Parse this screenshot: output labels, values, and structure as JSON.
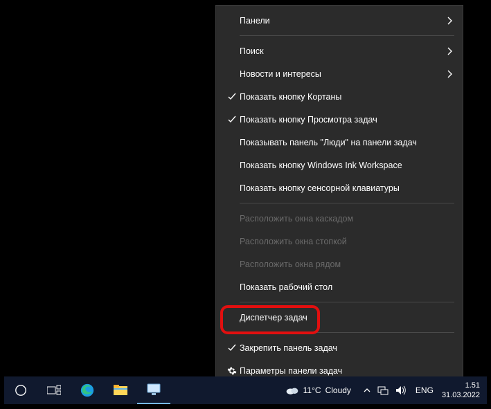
{
  "menu": {
    "items": [
      {
        "label": "Панели",
        "submenu": true
      },
      {
        "sep": true
      },
      {
        "label": "Поиск",
        "submenu": true
      },
      {
        "label": "Новости и интересы",
        "submenu": true
      },
      {
        "label": "Показать кнопку Кортаны",
        "checked": true
      },
      {
        "label": "Показать кнопку Просмотра задач",
        "checked": true
      },
      {
        "label": "Показывать панель \"Люди\" на панели задач"
      },
      {
        "label": "Показать кнопку Windows Ink Workspace"
      },
      {
        "label": "Показать кнопку сенсорной клавиатуры"
      },
      {
        "sep": true
      },
      {
        "label": "Расположить окна каскадом",
        "disabled": true
      },
      {
        "label": "Расположить окна стопкой",
        "disabled": true
      },
      {
        "label": "Расположить окна рядом",
        "disabled": true
      },
      {
        "label": "Показать рабочий стол"
      },
      {
        "sep": true
      },
      {
        "label": "Диспетчер задач",
        "highlighted": true
      },
      {
        "sep": true
      },
      {
        "label": "Закрепить панель задач",
        "checked": true
      },
      {
        "label": "Параметры панели задач",
        "gear": true
      }
    ]
  },
  "taskbar": {
    "weather_temp": "11°C",
    "weather_cond": "Cloudy",
    "lang": "ENG",
    "time": "1.51",
    "date": "31.03.2022"
  }
}
